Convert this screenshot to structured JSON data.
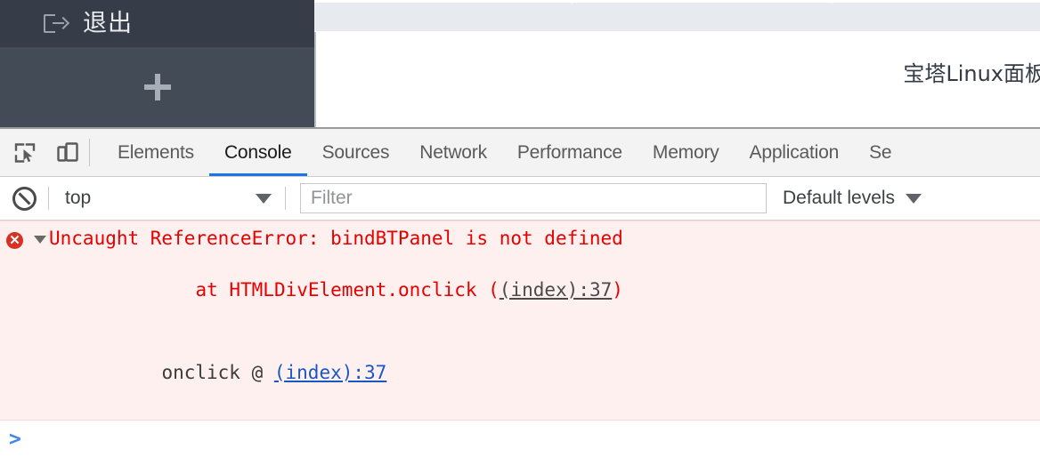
{
  "page": {
    "sidebar": {
      "logout_label": "退出",
      "logout_icon": "logout-icon",
      "add_icon": "plus-icon",
      "bg_color_top": "#363d48",
      "bg_color_bottom": "#434b56"
    },
    "content": {
      "title": "宝塔Linux面板"
    }
  },
  "devtools": {
    "toolbar": {
      "inspect_icon": "inspect-element-icon",
      "device_icon": "device-toolbar-icon",
      "tabs": [
        {
          "label": "Elements",
          "active": false
        },
        {
          "label": "Console",
          "active": true
        },
        {
          "label": "Sources",
          "active": false
        },
        {
          "label": "Network",
          "active": false
        },
        {
          "label": "Performance",
          "active": false
        },
        {
          "label": "Memory",
          "active": false
        },
        {
          "label": "Application",
          "active": false
        },
        {
          "label": "Se",
          "active": false
        }
      ],
      "active_tab_underline_color": "#1a73e8"
    },
    "filterbar": {
      "clear_icon": "clear-console-icon",
      "context": "top",
      "context_caret": "▼",
      "filter_placeholder": "Filter",
      "filter_value": "",
      "levels": "Default levels",
      "levels_caret": "▼"
    },
    "console": {
      "messages": [
        {
          "severity": "error",
          "icon": "error-circle-icon",
          "expander": "▼",
          "line1": "Uncaught ReferenceError: bindBTPanel is not defined",
          "line2_prefix": "at HTMLDivElement.onclick (",
          "line2_link": "(index):37",
          "line2_suffix": ")",
          "line3_prefix": "onclick @ ",
          "line3_link": "(index):37",
          "bg_color": "#fff0f0",
          "text_color": "#e60000"
        }
      ],
      "prompt_symbol": ">",
      "prompt_color": "#4285f4",
      "prompt_value": ""
    }
  }
}
